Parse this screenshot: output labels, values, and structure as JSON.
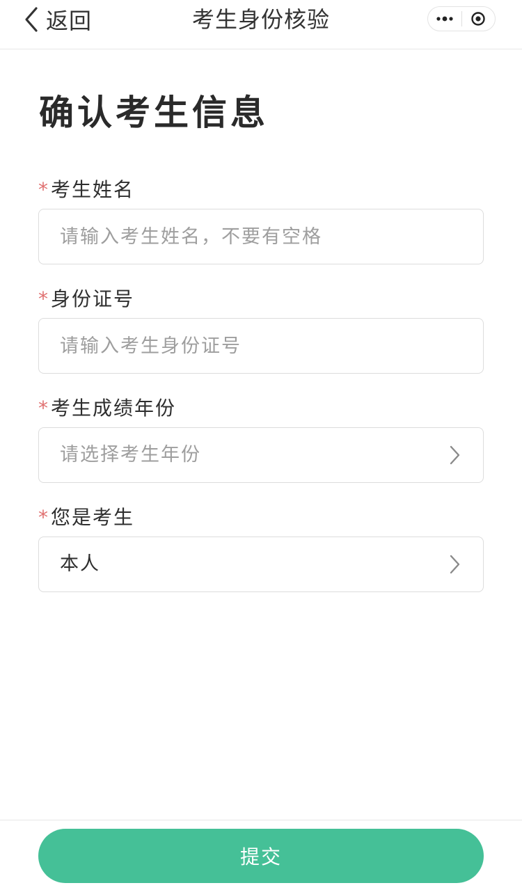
{
  "navbar": {
    "back_label": "返回",
    "title": "考生身份核验",
    "capsule": {
      "more_icon": "more-dots-icon",
      "close_icon": "target-circle-icon"
    }
  },
  "page": {
    "title": "确认考生信息"
  },
  "form": {
    "required_mark": "*",
    "name": {
      "label": "考生姓名",
      "placeholder": "请输入考生姓名，不要有空格",
      "value": ""
    },
    "id_number": {
      "label": "身份证号",
      "placeholder": "请输入考生身份证号",
      "value": ""
    },
    "score_year": {
      "label": "考生成绩年份",
      "placeholder": "请选择考生年份",
      "value": ""
    },
    "relation": {
      "label": "您是考生",
      "value": "本人"
    }
  },
  "footer": {
    "submit_label": "提交",
    "submit_color": "#45c097"
  },
  "colors": {
    "accent": "#45c097",
    "required": "#e07070",
    "placeholder": "#9e9e9e",
    "border": "#dcdcdc"
  }
}
